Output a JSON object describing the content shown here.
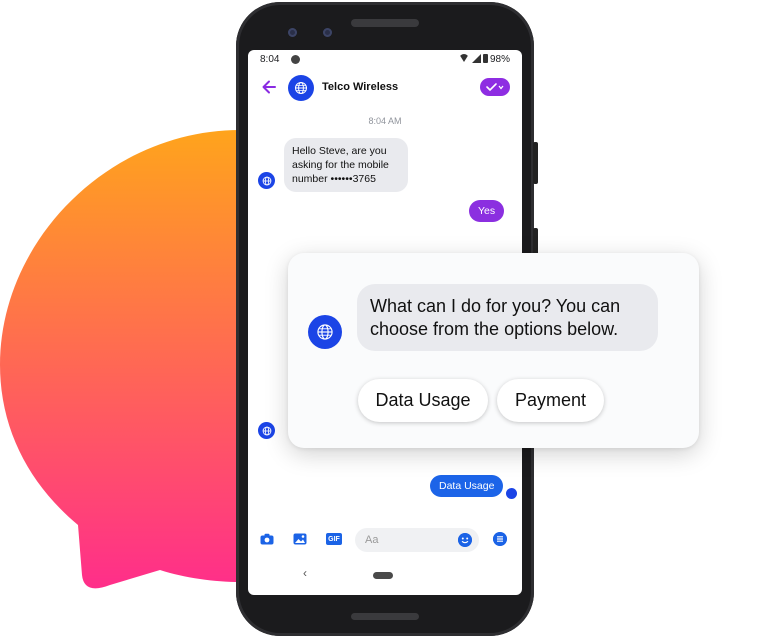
{
  "colors": {
    "accent_purple": "#8b2fe0",
    "brand_blue": "#1b44e6",
    "send_blue": "#1c64e8",
    "blob_top": "#ffa41c",
    "blob_bottom": "#ff2e8a"
  },
  "status_bar": {
    "time": "8:04",
    "battery": "98%",
    "icons": [
      "messenger-icon",
      "wifi-icon",
      "signal-icon",
      "battery-icon"
    ]
  },
  "header": {
    "back_icon": "arrow-left-icon",
    "contact_name": "Telco Wireless",
    "avatar_icon": "globe-icon",
    "action_icon": "check-dropdown-icon"
  },
  "conversation": {
    "timestamp": "8:04 AM",
    "messages": [
      {
        "from": "bot",
        "text": "Hello Steve, are you asking for the mobile number ••••••3765"
      },
      {
        "from": "user",
        "text": "Yes"
      },
      {
        "from": "user",
        "text": "Data Usage"
      }
    ]
  },
  "composer": {
    "icons": [
      "camera-icon",
      "image-icon",
      "gif-icon",
      "emoji-icon",
      "menu-icon"
    ],
    "gif_label": "GIF",
    "placeholder": "Aa"
  },
  "navbar": {
    "back_glyph": "‹"
  },
  "card": {
    "question": "What can I do for you? You can choose from the options below.",
    "options": [
      "Data Usage",
      "Payment"
    ]
  }
}
